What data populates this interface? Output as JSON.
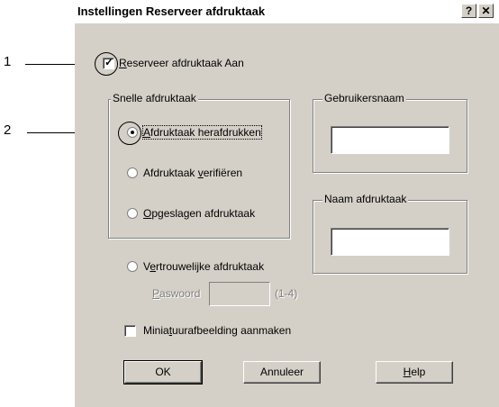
{
  "callouts": {
    "one": "1",
    "two": "2"
  },
  "dialog": {
    "title": "Instellingen Reserveer afdruktaak",
    "help_btn": "?",
    "close_btn": "✕",
    "reserve_checkbox": {
      "mnemonic": "R",
      "rest": "eserveer afdruktaak Aan",
      "checked": true
    },
    "quick_group": {
      "legend": "Snelle afdruktaak",
      "opt1": {
        "mnemonic": "A",
        "rest": "fdruktaak herafdrukken",
        "selected": true
      },
      "opt2": {
        "before": "Afdruktaak ",
        "mnemonic": "v",
        "rest": "erifiëren",
        "selected": false
      },
      "opt3": {
        "mnemonic": "O",
        "rest": "pgeslagen afdruktaak",
        "selected": false
      }
    },
    "username_group": {
      "legend": "Gebruikersnaam",
      "value": ""
    },
    "jobname_group": {
      "legend": "Naam afdruktaak",
      "value": ""
    },
    "confidential": {
      "before": "V",
      "mnemonic": "e",
      "rest": "rtrouwelijke afdruktaak",
      "selected": false
    },
    "password": {
      "mnemonic": "P",
      "rest": "aswoord",
      "value": "",
      "hint": "(1-4)"
    },
    "thumbnail": {
      "before": "Minia",
      "mnemonic": "t",
      "rest": "uurafbeelding aanmaken",
      "checked": false
    },
    "buttons": {
      "ok": "OK",
      "cancel": "Annuleer",
      "help_mnemonic": "H",
      "help_rest": "elp"
    }
  }
}
